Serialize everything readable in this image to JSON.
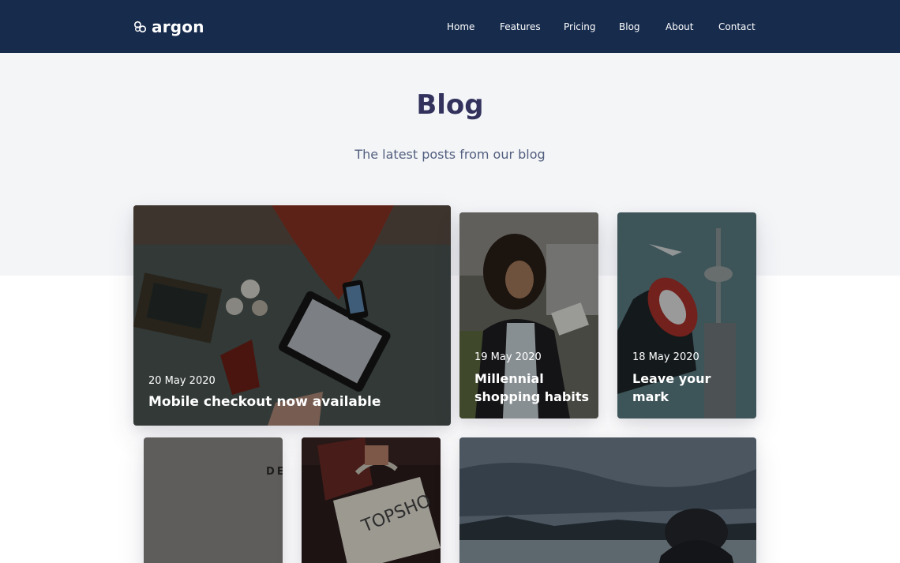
{
  "navbar": {
    "brand": "argon",
    "links": [
      "Home",
      "Features",
      "Pricing",
      "Blog",
      "About",
      "Contact"
    ],
    "background": "#172b4d"
  },
  "hero": {
    "title": "Blog",
    "subtitle": "The latest posts from our blog",
    "background": "#f4f5f7"
  },
  "posts": [
    {
      "date": "20 May 2020",
      "title": "Mobile checkout now available"
    },
    {
      "date": "19 May 2020",
      "title": "Millennial shopping habits"
    },
    {
      "date": "18 May 2020",
      "title": "Leave your mark"
    },
    {
      "date": "",
      "title": ""
    },
    {
      "date": "",
      "title": ""
    },
    {
      "date": "",
      "title": ""
    }
  ],
  "colors": {
    "title": "#32325d",
    "subtitle": "#525f7f",
    "white": "#ffffff"
  }
}
